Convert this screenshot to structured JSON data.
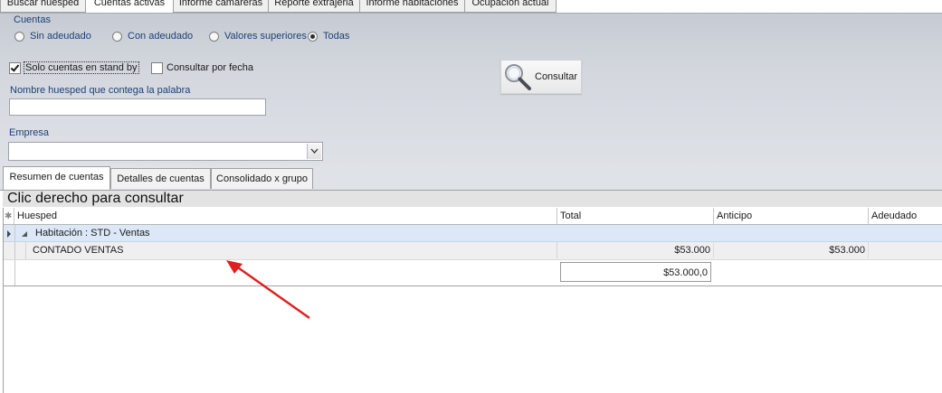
{
  "top_tabs": [
    {
      "label": "Buscar huesped",
      "active": false
    },
    {
      "label": "Cuentas activas",
      "active": true
    },
    {
      "label": "Informe camareras",
      "active": false
    },
    {
      "label": "Reporte extrajeria",
      "active": false
    },
    {
      "label": "Informe habitaciones",
      "active": false
    },
    {
      "label": "Ocupacion actual",
      "active": false
    }
  ],
  "filters": {
    "cuentas_label": "Cuentas",
    "radios": [
      {
        "label": "Sin adeudado",
        "checked": false
      },
      {
        "label": "Con adeudado",
        "checked": false
      },
      {
        "label": "Valores superiores",
        "checked": false
      },
      {
        "label": "Todas",
        "checked": true
      }
    ],
    "standby_label": "Solo cuentas en stand by",
    "standby_checked": true,
    "por_fecha_label": "Consultar por fecha",
    "por_fecha_checked": false,
    "nombre_label": "Nombre huesped que contega la palabra",
    "nombre_value": "",
    "empresa_label": "Empresa",
    "empresa_value": "",
    "consultar_label": "Consultar"
  },
  "sub_tabs": [
    {
      "label": "Resumen de cuentas",
      "active": true
    },
    {
      "label": "Detalles de cuentas",
      "active": false
    },
    {
      "label": "Consolidado x grupo",
      "active": false
    }
  ],
  "grid": {
    "caption": "Clic derecho para consultar",
    "header_marker": "✱",
    "columns": [
      "Huesped",
      "Total",
      "Anticipo",
      "Adeudado"
    ],
    "group_row": "Habitación : STD - Ventas",
    "data_row": {
      "huesped": "CONTADO VENTAS",
      "total": "$53.000",
      "anticipo": "$53.000",
      "adeudado": ""
    },
    "summary_total": "$53.000,0"
  },
  "colors": {
    "annotation_arrow": "#e02020",
    "label_blue": "#1c3f7a",
    "group_row_bg": "#dce8f7"
  }
}
